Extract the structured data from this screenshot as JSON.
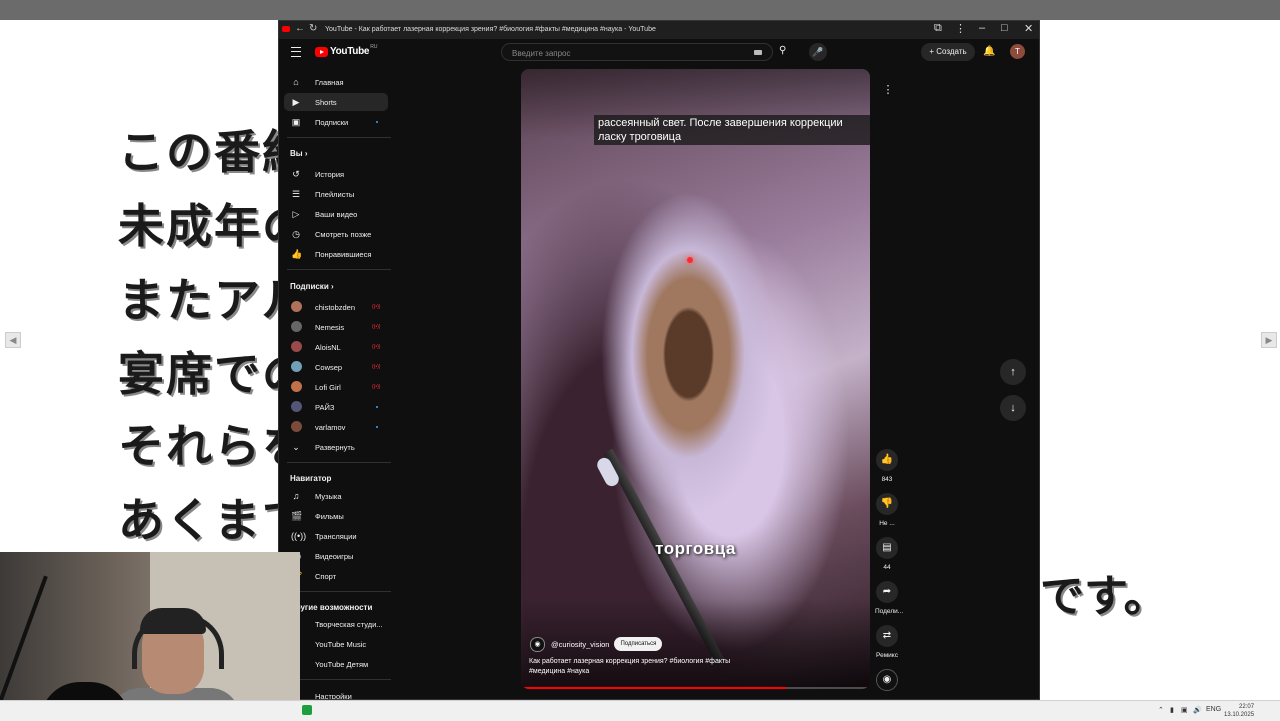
{
  "background": {
    "japanese_lines": [
      "この番組",
      "未成年の",
      "またアル",
      "宴席での",
      "それらを",
      "あくまで"
    ],
    "right_text": "です。"
  },
  "browser": {
    "title": "YouTube - Как работает лазерная коррекция зрения? #биология #факты #медицина #наука - YouTube"
  },
  "masthead": {
    "logo_text": "YouTube",
    "region": "RU",
    "search_placeholder": "Введите запрос",
    "create_label": "Создать",
    "avatar_letter": "T"
  },
  "sidebar": {
    "main": [
      {
        "label": "Главная",
        "icon": "home-icon"
      },
      {
        "label": "Shorts",
        "icon": "shorts-icon"
      },
      {
        "label": "Подписки",
        "icon": "subscriptions-icon"
      }
    ],
    "you_header": "Вы",
    "you": [
      {
        "label": "История",
        "icon": "history-icon"
      },
      {
        "label": "Плейлисты",
        "icon": "playlists-icon"
      },
      {
        "label": "Ваши видео",
        "icon": "your-videos-icon"
      },
      {
        "label": "Смотреть позже",
        "icon": "watch-later-icon"
      },
      {
        "label": "Понравившиеся",
        "icon": "like-icon"
      }
    ],
    "subs_header": "Подписки",
    "channels": [
      {
        "label": "chistobzden",
        "color": "#b0705a"
      },
      {
        "label": "Nemesis",
        "color": "#666666"
      },
      {
        "label": "AloisNL",
        "color": "#9a4a4a"
      },
      {
        "label": "Cowsep",
        "color": "#6fa0b8"
      },
      {
        "label": "Lofi Girl",
        "color": "#c2704a"
      },
      {
        "label": "РАЙЗ",
        "color": "#555577"
      },
      {
        "label": "varlamov",
        "color": "#7a4a3a"
      }
    ],
    "expand_label": "Развернуть",
    "nav_header": "Навигатор",
    "nav": [
      {
        "label": "Музыка",
        "icon": "music-icon"
      },
      {
        "label": "Фильмы",
        "icon": "film-icon"
      },
      {
        "label": "Трансляции",
        "icon": "live-icon"
      },
      {
        "label": "Видеоигры",
        "icon": "gaming-icon"
      },
      {
        "label": "Спорт",
        "icon": "sport-icon"
      }
    ],
    "more_header": "Другие возможности",
    "more": [
      {
        "label": "Творческая студи..."
      },
      {
        "label": "YouTube Music"
      },
      {
        "label": "YouTube Детям"
      }
    ],
    "settings_label": "Настройки"
  },
  "short": {
    "caption_top": "рассеянный свет. После завершения коррекции ласку троговица",
    "caption_mid": "торговца",
    "channel": "@curiosity_vision",
    "subscribe_label": "Подписаться",
    "description": "Как работает лазерная коррекция зрения? #биология #факты #медицина #наука",
    "progress": 0.76
  },
  "actions": {
    "likes": "843",
    "dislike_label": "Не ...",
    "comments": "44",
    "share_label": "Подели...",
    "remix_label": "Ремикс"
  },
  "taskbar": {
    "lang": "ENG",
    "time": "22:07",
    "date": "13.10.2025"
  }
}
